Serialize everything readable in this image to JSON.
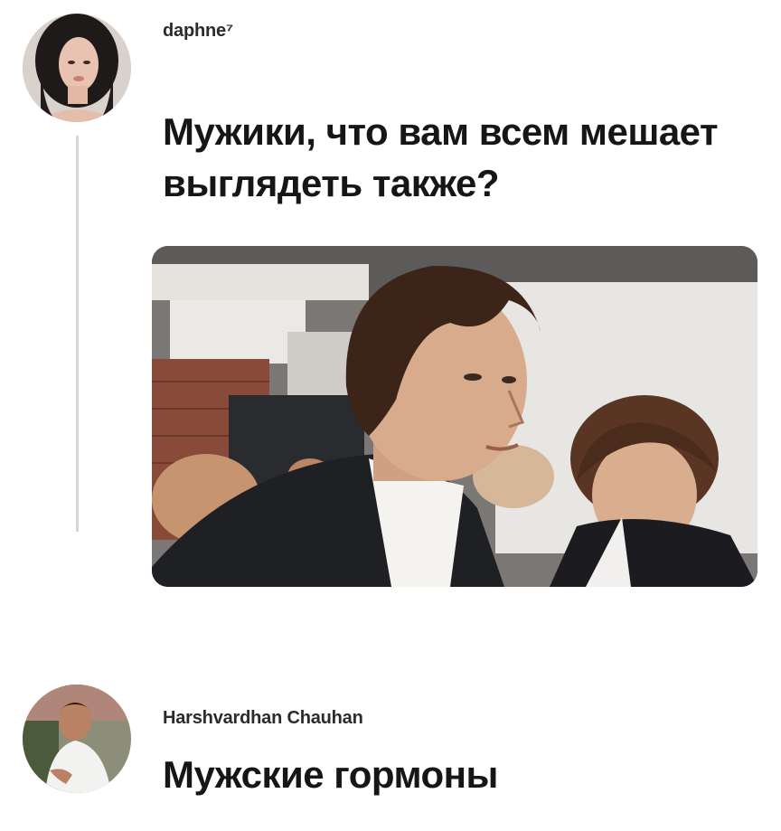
{
  "post": {
    "username": "daphne⁷",
    "text": "Мужики, что вам всем мешает выглядеть также?"
  },
  "reply": {
    "username": "Harshvardhan Chauhan",
    "text": "Мужские гормоны"
  }
}
